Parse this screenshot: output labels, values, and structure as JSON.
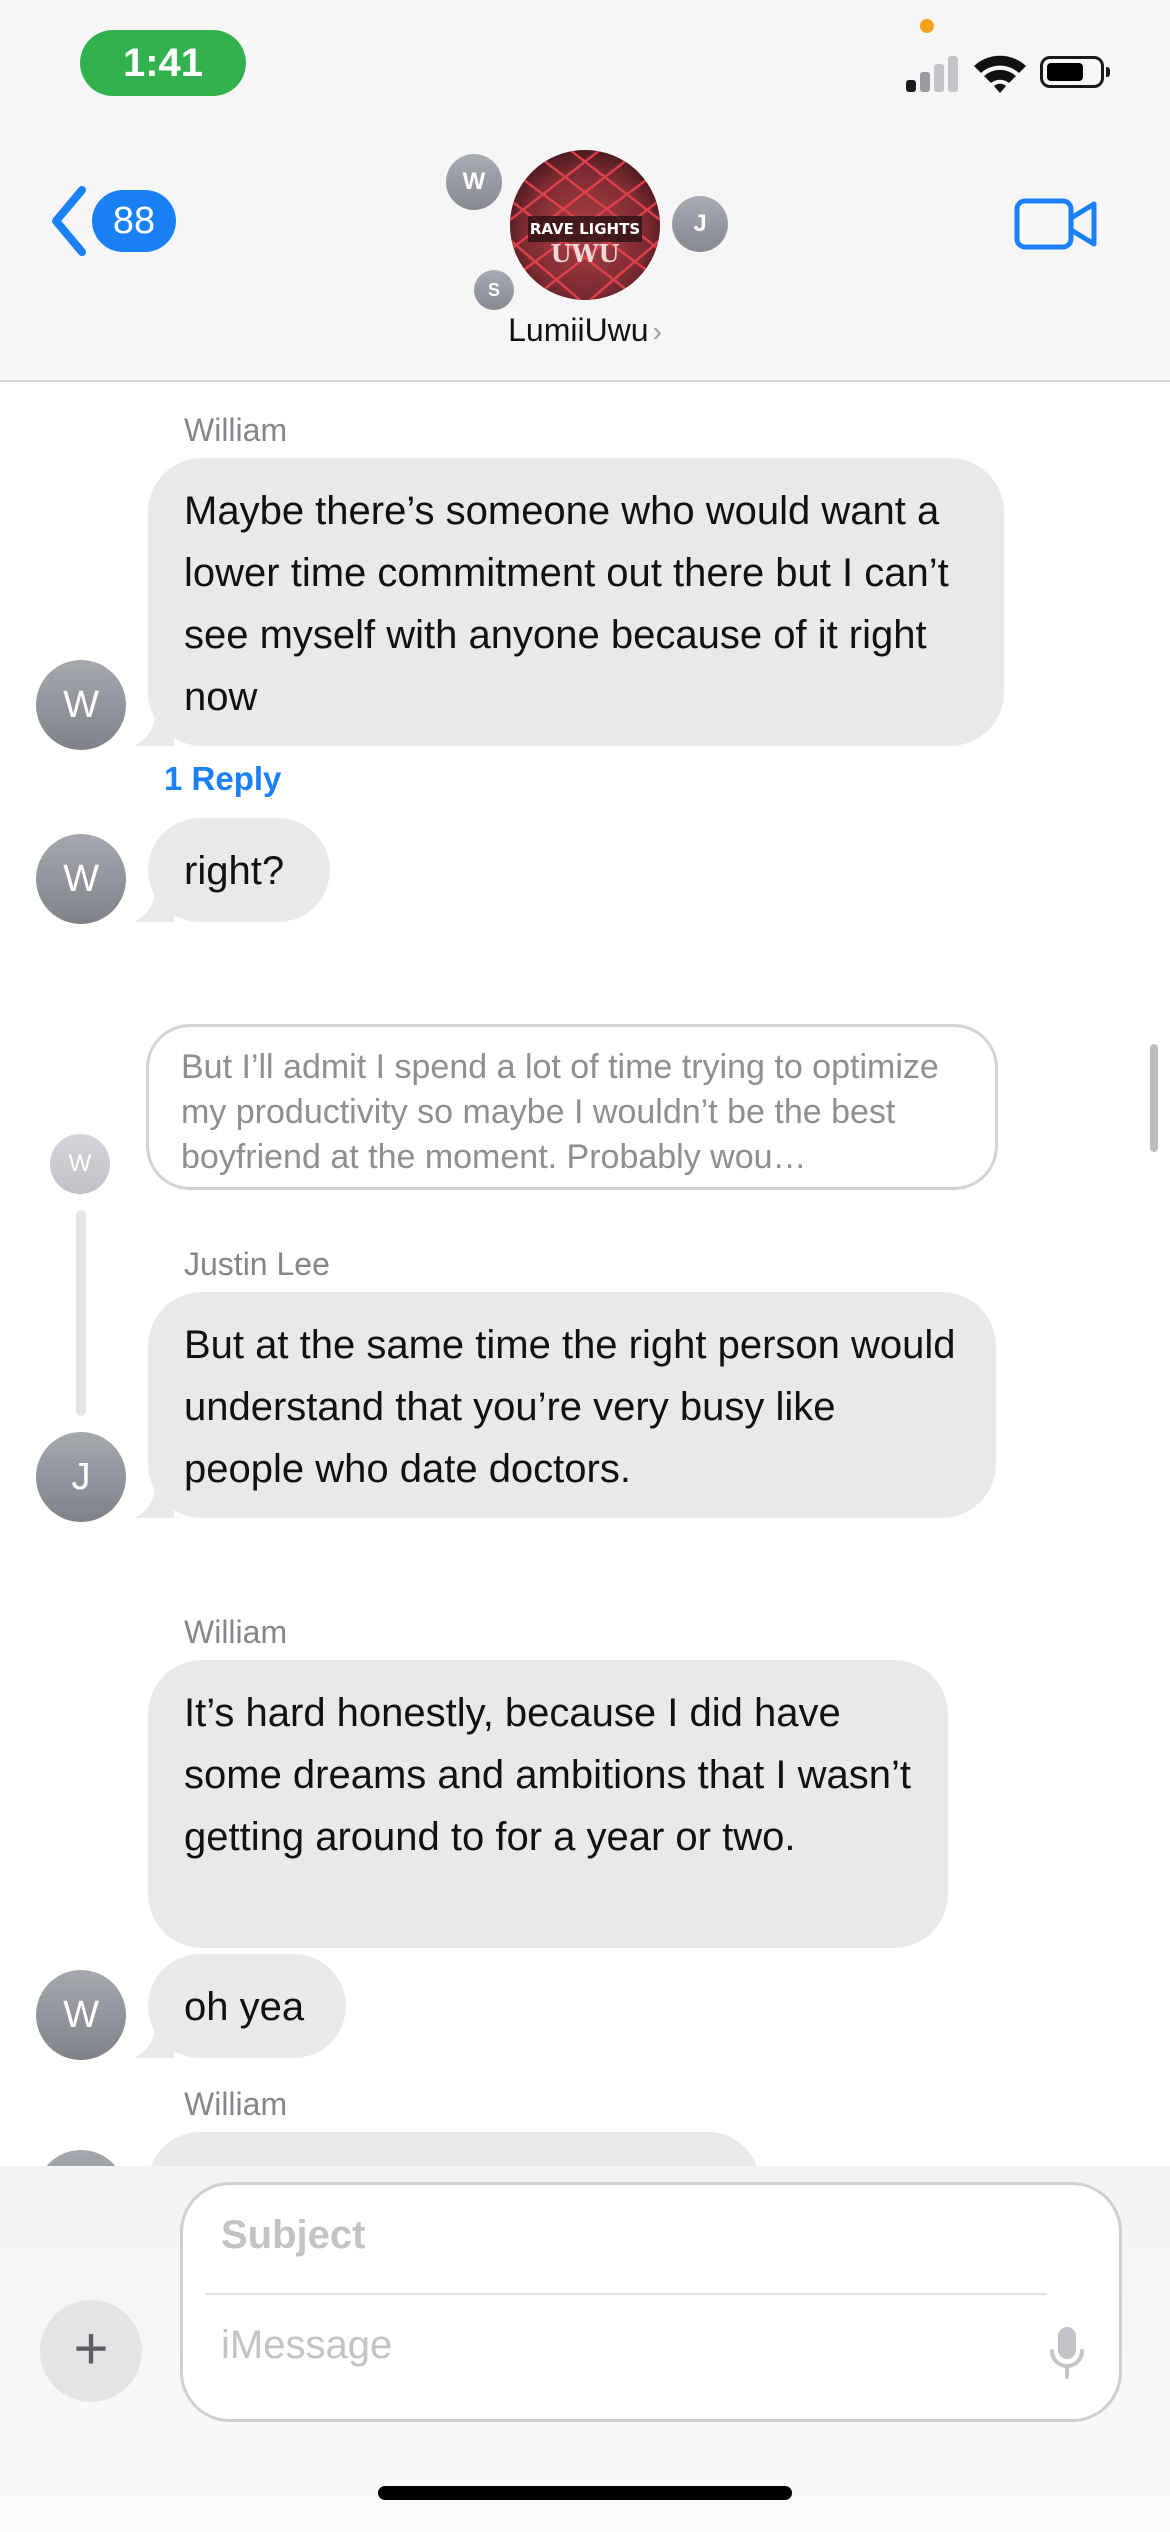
{
  "status_bar": {
    "time": "1:41"
  },
  "header": {
    "back_count": "88",
    "group_name": "LumiiUwu",
    "group_avatar_text_top": "RAVE LIGHTS",
    "group_avatar_text_bottom": "UWU",
    "member_initials": [
      "W",
      "J",
      "S"
    ]
  },
  "messages": {
    "m1": {
      "sender": "William",
      "text": "Maybe there’s someone who would want a lower time commitment out there but I can’t see myself with anyone because of it right now",
      "avatar": "W",
      "reply_label": "1 Reply"
    },
    "m2": {
      "text": "right?",
      "avatar": "W"
    },
    "quoted": {
      "text": "But I’ll admit I spend a lot of time trying to optimize my productivity so maybe I wouldn’t be the best boyfriend at the moment. Probably wou…",
      "avatar": "W"
    },
    "m3": {
      "sender": "Justin Lee",
      "text": "But at the same time the right person would understand that you’re very busy like people who date doctors.",
      "avatar": "J"
    },
    "m4": {
      "sender": "William",
      "text": "It’s hard honestly, because I did have some dreams and ambitions that I wasn’t getting around to for a year or two."
    },
    "m5": {
      "text": "oh yea",
      "avatar": "W"
    },
    "m6": {
      "sender": "William"
    }
  },
  "composer": {
    "subject_placeholder": "Subject",
    "message_placeholder": "iMessage"
  },
  "colors": {
    "accent": "#1a80f5",
    "time_pill": "#34b14f",
    "bubble": "#e9e9eb"
  }
}
